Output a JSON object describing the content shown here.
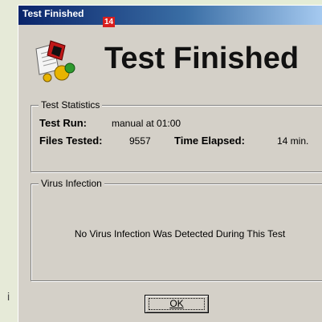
{
  "window": {
    "title": "Test Finished",
    "badge": "14",
    "heading": "Test Finished"
  },
  "stats": {
    "legend": "Test Statistics",
    "test_run_label": "Test Run:",
    "test_run_value": "manual at 01:00",
    "files_tested_label": "Files Tested:",
    "files_tested_value": "9557",
    "time_elapsed_label": "Time Elapsed:",
    "time_elapsed_value": "14 min."
  },
  "virus": {
    "legend": "Virus Infection",
    "message": "No Virus Infection Was Detected During This Test"
  },
  "buttons": {
    "ok_label": "OK"
  },
  "background": {
    "stray_letter": "i"
  },
  "colors": {
    "title_gradient_start": "#0a246a",
    "dialog_face": "#d4d0c8",
    "badge_red": "#d81e1e"
  },
  "icons": [
    "antivirus-app-icon"
  ]
}
